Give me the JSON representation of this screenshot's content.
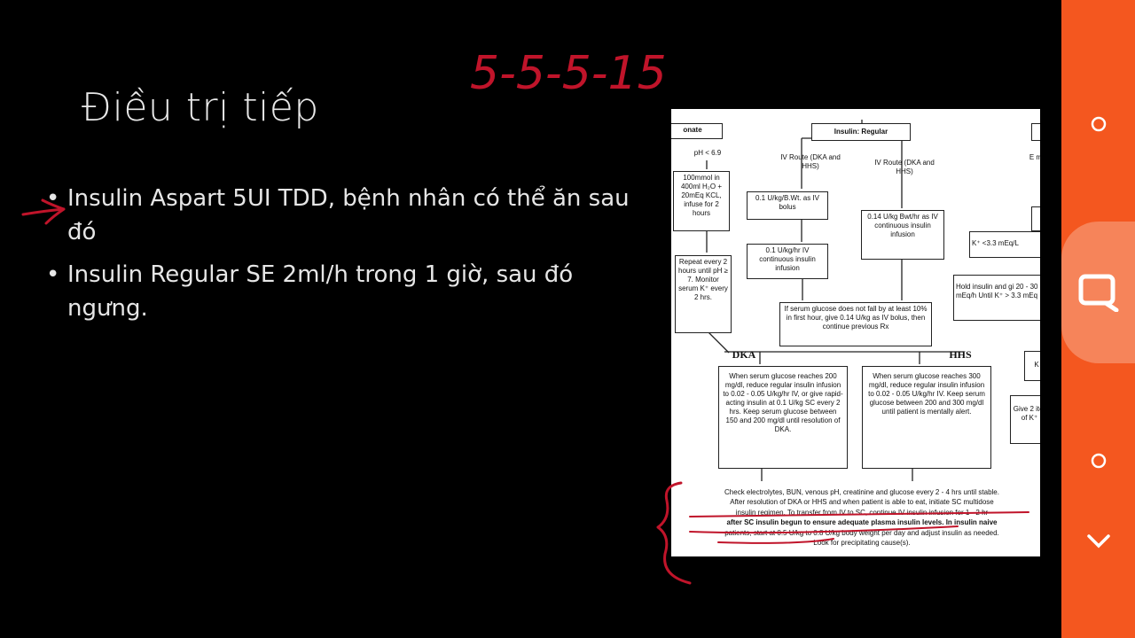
{
  "slide": {
    "title": "Điều trị tiếp",
    "bullets": [
      "Insulin Aspart 5UI TDD, bệnh nhân có thể ăn sau đó",
      "Insulin Regular SE 2ml/h trong 1 giờ, sau đó ngưng."
    ],
    "handwriting": "5-5-5-15",
    "annotation_color": "#c0142a"
  },
  "flowchart": {
    "header_left": "onate",
    "header_mid": "Insulin: Regular",
    "ph": "pH < 6.9",
    "bicarb_box": "100mmol in 400ml H₂O + 20mEq KCL, infuse for 2 hours",
    "repeat_box": "Repeat every 2 hours until pH ≥ 7. Monitor serum K⁺ every 2 hrs.",
    "iv_route_1": "IV Route (DKA and HHS)",
    "iv_route_2": "IV Route (DKA and HHS)",
    "bolus_box": "0.1 U/kg/B.Wt. as IV bolus",
    "infusion_box": "0.1 U/kg/hr IV continuous insulin infusion",
    "continuous_box": "0.14 U/kg Bwt/hr as IV continuous insulin infusion",
    "glucose_fall_box": "If serum glucose does not fall by at least 10% in first hour, give 0.14 U/kg as IV bolus, then continue previous Rx",
    "dka_label": "DKA",
    "hhs_label": "HHS",
    "dka_box": "When serum glucose reaches 200 mg/dl, reduce regular insulin infusion to 0.02 - 0.05 U/kg/hr IV, or give rapid-acting insulin at 0.1 U/kg SC every 2 hrs. Keep serum glucose between 150 and 200 mg/dl until resolution of DKA.",
    "hhs_box": "When serum glucose reaches 300 mg/dl, reduce regular insulin infusion to 0.02 - 0.05 U/kg/hr IV. Keep serum glucose between 200 and 300 mg/dl until patient is mentally alert.",
    "right_1": "E m",
    "right_k": "K⁺ <3.3 mEq/L",
    "right_hold": "Hold insulin and gi 20 - 30 mEq/h Until K⁺ > 3.3 mEq",
    "right_k2": "K",
    "right_give": "Give 2 iter of K⁺",
    "bottom_line1": "Check electrolytes, BUN, venous pH, creatinine and glucose every 2 - 4 hrs until stable.",
    "bottom_line2": "After resolution of DKA or HHS and when patient is able to eat, initiate SC multidose",
    "bottom_line3": "insulin regimen. To transfer from IV to SC, continue IV insulin infusion for 1 - 2 hr",
    "bottom_line4": "after SC insulin begun to ensure adequate plasma insulin levels. In insulin naive",
    "bottom_line5": "patients, start at 0.5 U/kg to 0.8 U/kg body weight per day and adjust insulin as needed.",
    "bottom_line6": "Look for precipitating cause(s)."
  },
  "side_panel": {
    "color": "#f4571f",
    "highlight_color": "#f6845a",
    "buttons": [
      "circle-icon",
      "quote-icon",
      "circle-icon",
      "chevron-down-icon"
    ]
  }
}
